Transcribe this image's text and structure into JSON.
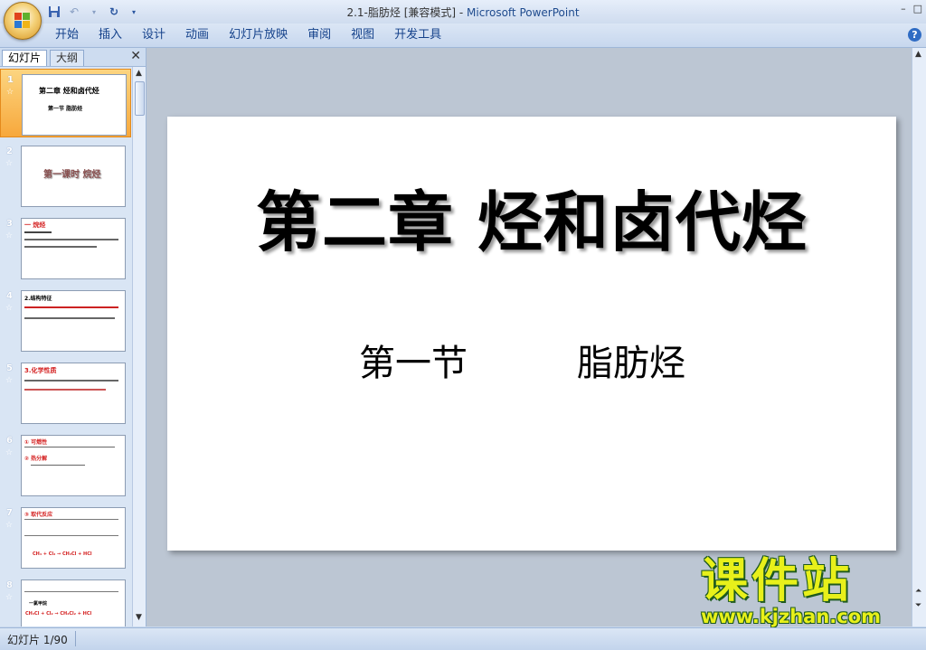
{
  "window": {
    "doc_title": "2.1-脂肪烃 [兼容模式] - ",
    "app_name": "Microsoft PowerPoint",
    "controls": [
      "–",
      "□"
    ]
  },
  "ribbon": {
    "tabs": [
      "开始",
      "插入",
      "设计",
      "动画",
      "幻灯片放映",
      "审阅",
      "视图",
      "开发工具"
    ]
  },
  "left_pane": {
    "tab_slides": "幻灯片",
    "tab_outline": "大纲",
    "close": "✕",
    "thumbnails": [
      {
        "num": "1",
        "star": "☆",
        "line1": "第二章  烃和卤代烃",
        "line2": "第一节     脂肪烃"
      },
      {
        "num": "2",
        "star": "☆",
        "line1": "第一课时 烷烃"
      },
      {
        "num": "3",
        "star": "☆",
        "line1": "一 烷烃"
      },
      {
        "num": "4",
        "star": "☆",
        "line1": "2.结构特征"
      },
      {
        "num": "5",
        "star": "☆",
        "line1": "3.化学性质"
      },
      {
        "num": "6",
        "star": "☆",
        "line1": "① 可燃性",
        "line2": "② 热分解"
      },
      {
        "num": "7",
        "star": "☆",
        "line1": "③ 取代反应",
        "line2": "CH₄ + Cl₂ → CH₃Cl + HCl"
      },
      {
        "num": "8",
        "star": "☆",
        "line1": "一氯甲烷",
        "line2": "CH₃Cl + Cl₂ → CH₂Cl₂ + HCl"
      }
    ]
  },
  "slide": {
    "title": "第二章  烃和卤代烃",
    "subtitle_left": "第一节",
    "subtitle_right": "脂肪烃"
  },
  "watermark": {
    "brand": "课件站",
    "url": "www.kjzhan.com"
  },
  "status": {
    "slide_counter": "幻灯片 1/90"
  }
}
